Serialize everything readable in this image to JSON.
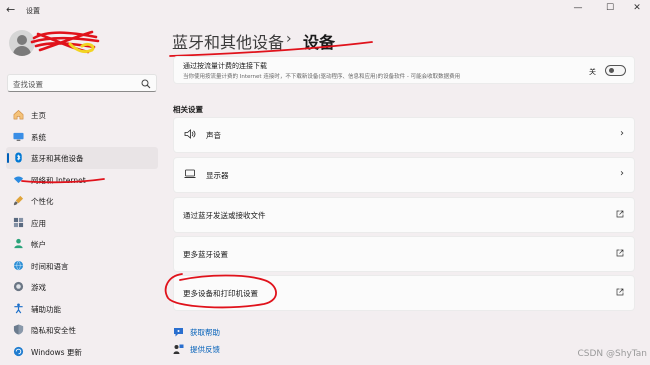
{
  "window": {
    "title": "设置",
    "back_glyph": "←",
    "controls": {
      "minimize": "—",
      "maximize": "☐",
      "close": "✕"
    }
  },
  "sidebar": {
    "search_placeholder": "查找设置",
    "items": [
      {
        "label": "主页",
        "icon": "home-icon",
        "active": false
      },
      {
        "label": "系统",
        "icon": "monitor-icon",
        "active": false
      },
      {
        "label": "蓝牙和其他设备",
        "icon": "bluetooth-icon",
        "active": true
      },
      {
        "label": "网络和 Internet",
        "icon": "wifi-icon",
        "active": false
      },
      {
        "label": "个性化",
        "icon": "brush-icon",
        "active": false
      },
      {
        "label": "应用",
        "icon": "apps-icon",
        "active": false
      },
      {
        "label": "帐户",
        "icon": "person-icon",
        "active": false
      },
      {
        "label": "时间和语言",
        "icon": "globe-clock-icon",
        "active": false
      },
      {
        "label": "游戏",
        "icon": "gamepad-icon",
        "active": false
      },
      {
        "label": "辅助功能",
        "icon": "accessibility-icon",
        "active": false
      },
      {
        "label": "隐私和安全性",
        "icon": "shield-icon",
        "active": false
      },
      {
        "label": "Windows 更新",
        "icon": "update-icon",
        "active": false
      }
    ]
  },
  "breadcrumb": {
    "parent": "蓝牙和其他设备",
    "separator": "›",
    "current": "设备"
  },
  "metered": {
    "title": "通过按流量计费的连接下载",
    "description": "当你使用按流量计费的 Internet 连接时，不下载新设备(驱动程序、信息和应用)的设备软件 - 可能会收取数据费用",
    "toggle_label": "关",
    "toggle_on": false
  },
  "related": {
    "section_title": "相关设置",
    "rows": [
      {
        "label": "声音",
        "icon": "speaker-icon",
        "trail": "chevron"
      },
      {
        "label": "显示器",
        "icon": "display-icon",
        "trail": "chevron"
      },
      {
        "label": "通过蓝牙发送或接收文件",
        "icon": "",
        "trail": "external"
      },
      {
        "label": "更多蓝牙设置",
        "icon": "",
        "trail": "external"
      },
      {
        "label": "更多设备和打印机设置",
        "icon": "",
        "trail": "external"
      }
    ]
  },
  "help": [
    {
      "label": "获取帮助",
      "icon": "help-icon"
    },
    {
      "label": "提供反馈",
      "icon": "feedback-icon"
    }
  ],
  "watermark": "CSDN @ShyTan",
  "colors": {
    "accent": "#005fb8",
    "annotation": "#e0121b",
    "background": "#f3eef0",
    "card": "#fbfbfb"
  }
}
